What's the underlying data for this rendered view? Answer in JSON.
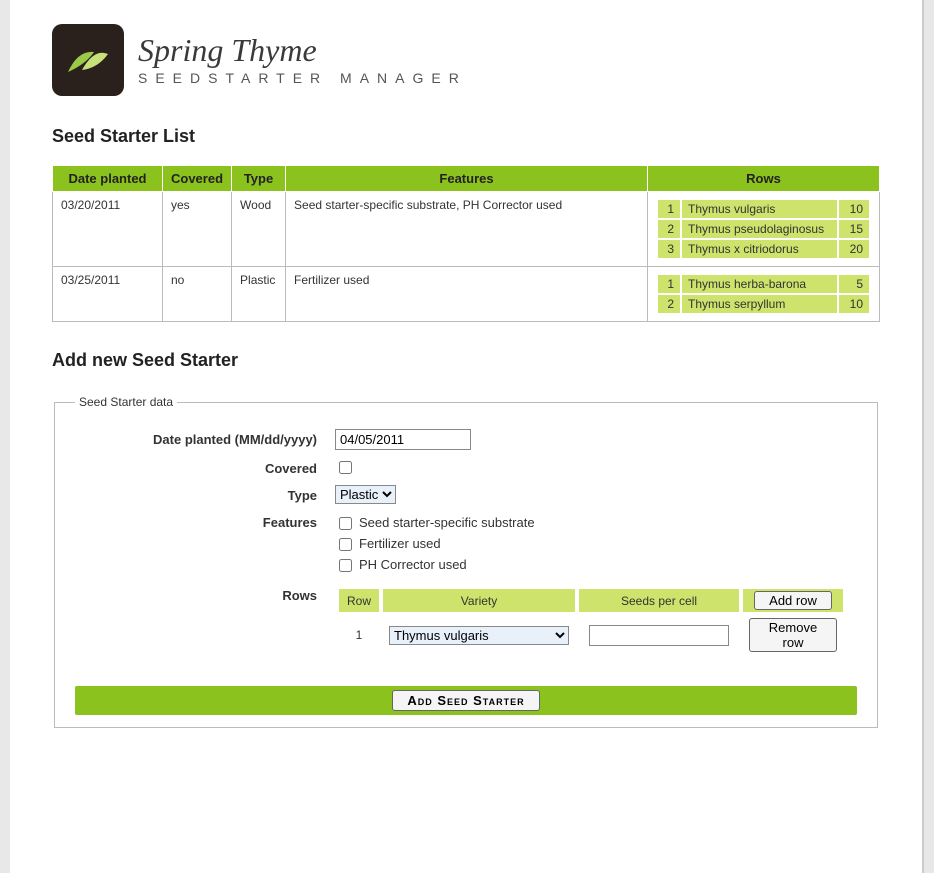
{
  "brand": {
    "title": "Spring Thyme",
    "subtitle": "SEEDSTARTER  MANAGER"
  },
  "list": {
    "heading": "Seed Starter List",
    "columns": {
      "date": "Date planted",
      "covered": "Covered",
      "type": "Type",
      "features": "Features",
      "rows": "Rows"
    },
    "entries": [
      {
        "date": "03/20/2011",
        "covered": "yes",
        "type": "Wood",
        "features": "Seed starter-specific substrate, PH Corrector used",
        "rows": [
          {
            "n": "1",
            "variety": "Thymus vulgaris",
            "count": "10"
          },
          {
            "n": "2",
            "variety": "Thymus pseudolaginosus",
            "count": "15"
          },
          {
            "n": "3",
            "variety": "Thymus x citriodorus",
            "count": "20"
          }
        ]
      },
      {
        "date": "03/25/2011",
        "covered": "no",
        "type": "Plastic",
        "features": "Fertilizer used",
        "rows": [
          {
            "n": "1",
            "variety": "Thymus herba-barona",
            "count": "5"
          },
          {
            "n": "2",
            "variety": "Thymus serpyllum",
            "count": "10"
          }
        ]
      }
    ]
  },
  "form": {
    "heading": "Add new Seed Starter",
    "legend": "Seed Starter data",
    "labels": {
      "date": "Date planted (MM/dd/yyyy)",
      "covered": "Covered",
      "type": "Type",
      "features": "Features",
      "rows": "Rows"
    },
    "values": {
      "date": "04/05/2011",
      "covered": false,
      "type_selected": "Plastic",
      "type_options": [
        "Plastic"
      ]
    },
    "features": [
      {
        "label": "Seed starter-specific substrate",
        "checked": false
      },
      {
        "label": "Fertilizer used",
        "checked": false
      },
      {
        "label": "PH Corrector used",
        "checked": false
      }
    ],
    "rows_table": {
      "headers": {
        "row": "Row",
        "variety": "Variety",
        "seeds": "Seeds per cell"
      },
      "add_row_label": "Add row",
      "remove_row_label": "Remove row",
      "rows": [
        {
          "n": "1",
          "variety_selected": "Thymus vulgaris",
          "seeds": ""
        }
      ],
      "variety_options": [
        "Thymus vulgaris"
      ]
    },
    "submit_label": "Add Seed Starter"
  }
}
